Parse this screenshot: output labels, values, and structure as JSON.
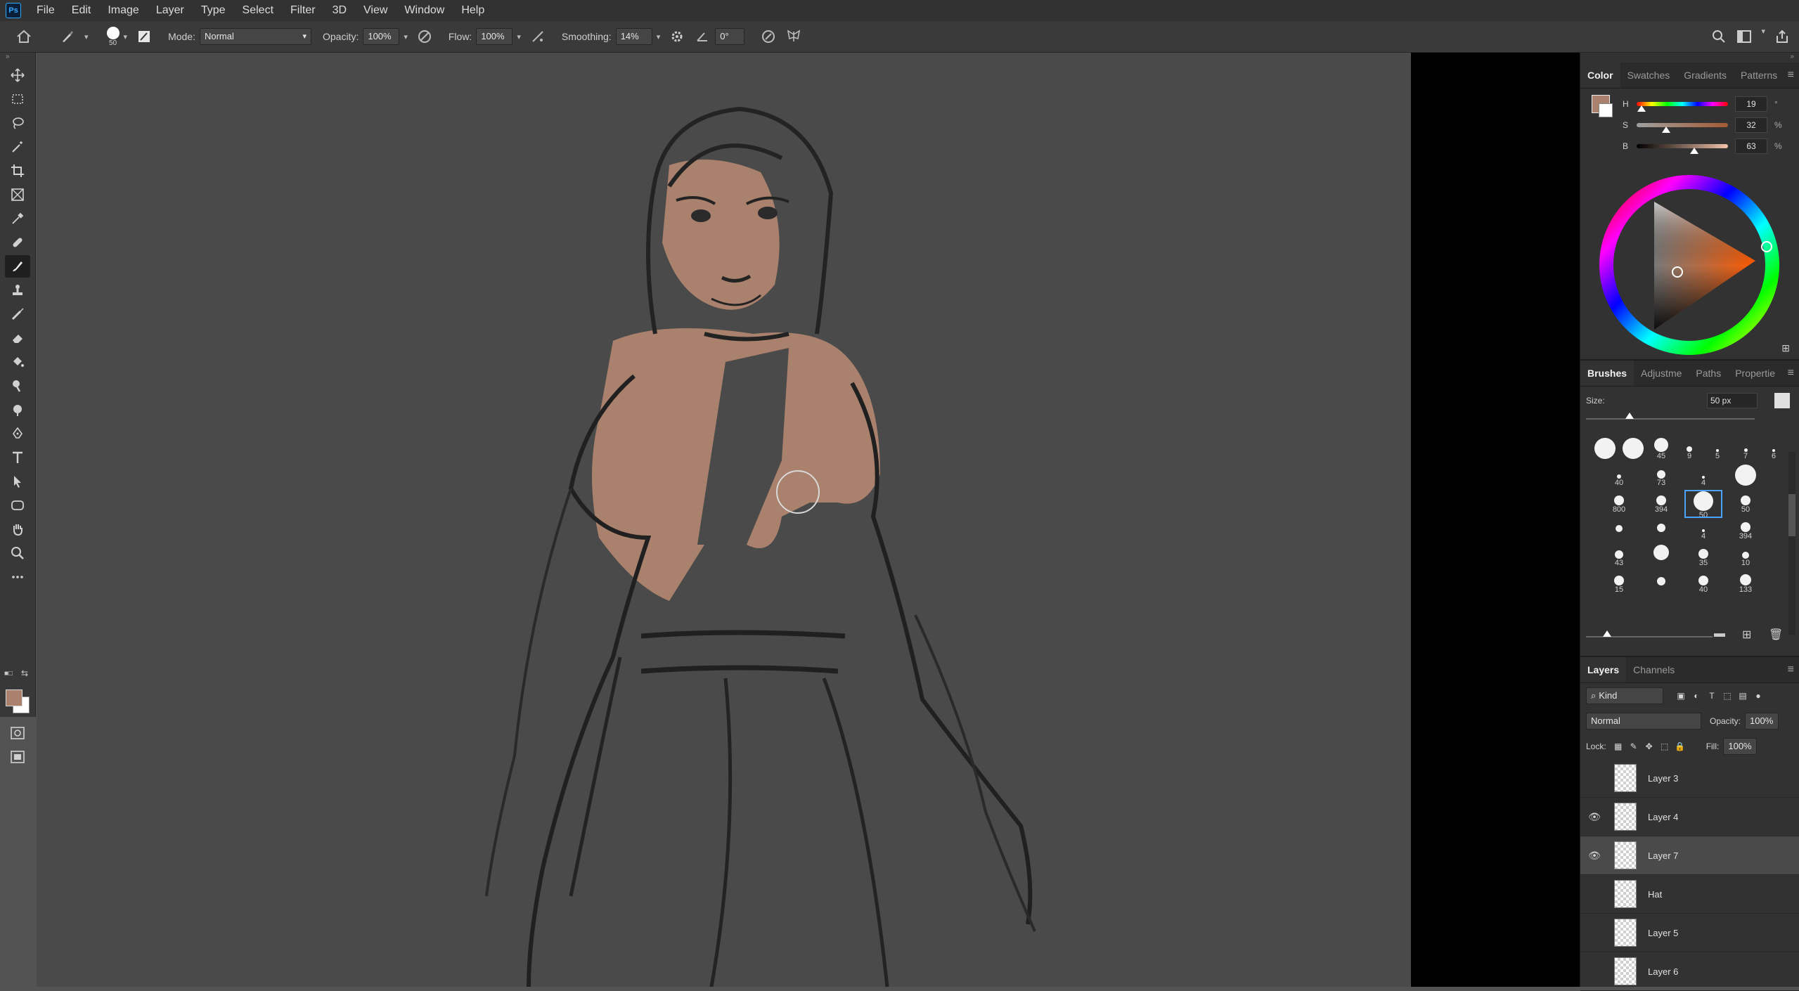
{
  "app": {
    "logo": "Ps"
  },
  "menu": [
    "File",
    "Edit",
    "Image",
    "Layer",
    "Type",
    "Select",
    "Filter",
    "3D",
    "View",
    "Window",
    "Help"
  ],
  "options": {
    "brush_size": "50",
    "mode_label": "Mode:",
    "mode_value": "Normal",
    "opacity_label": "Opacity:",
    "opacity_value": "100%",
    "flow_label": "Flow:",
    "flow_value": "100%",
    "smoothing_label": "Smoothing:",
    "smoothing_value": "14%",
    "angle_value": "0°"
  },
  "tools": [
    "move-tool",
    "marquee-tool",
    "lasso-tool",
    "magic-wand-tool",
    "crop-tool",
    "frame-tool",
    "eyedropper-tool",
    "healing-tool",
    "brush-tool",
    "stamp-tool",
    "history-brush-tool",
    "eraser-tool",
    "paint-bucket-tool",
    "smudge-tool",
    "dodge-tool",
    "pen-tool",
    "type-tool",
    "path-selection-tool",
    "rectangle-tool",
    "hand-tool",
    "zoom-tool",
    "more-tools"
  ],
  "colors": {
    "foreground": "#a9816c",
    "background": "#ffffff"
  },
  "color_panel": {
    "tabs": [
      "Color",
      "Swatches",
      "Gradients",
      "Patterns"
    ],
    "h_label": "H",
    "h_value": "19",
    "h_unit": "°",
    "h_level": 0.05,
    "s_label": "S",
    "s_value": "32",
    "s_unit": "%",
    "s_level": 0.32,
    "b_label": "B",
    "b_value": "63",
    "b_unit": "%",
    "b_level": 0.63
  },
  "brushes_panel": {
    "tabs": [
      "Brushes",
      "Adjustme",
      "Paths",
      "Propertie"
    ],
    "size_label": "Size:",
    "size_value": "50 px",
    "presets": [
      {
        "label": "",
        "size": 30
      },
      {
        "label": "",
        "size": 34
      },
      {
        "label": "45",
        "size": 20
      },
      {
        "label": "9",
        "size": 8
      },
      {
        "label": "5",
        "size": 4
      },
      {
        "label": "7",
        "size": 5
      },
      {
        "label": "6",
        "size": 4
      },
      {
        "label": "40",
        "size": 6
      },
      {
        "label": "73",
        "size": 12
      },
      {
        "label": "4",
        "size": 4
      },
      {
        "label": "",
        "size": 30
      },
      {
        "label": "800",
        "size": 14
      },
      {
        "label": "394",
        "size": 14
      },
      {
        "label": "50",
        "size": 28
      },
      {
        "label": "50",
        "size": 14
      },
      {
        "label": "",
        "size": 10
      },
      {
        "label": "",
        "size": 12
      },
      {
        "label": "4",
        "size": 4
      },
      {
        "label": "394",
        "size": 14
      },
      {
        "label": "43",
        "size": 12
      },
      {
        "label": "",
        "size": 22
      },
      {
        "label": "35",
        "size": 14
      },
      {
        "label": "10",
        "size": 10
      },
      {
        "label": "15",
        "size": 14
      },
      {
        "label": "",
        "size": 12
      },
      {
        "label": "40",
        "size": 14
      },
      {
        "label": "133",
        "size": 16
      }
    ]
  },
  "layers_panel": {
    "tabs": [
      "Layers",
      "Channels"
    ],
    "filter_label": "Kind",
    "blend_mode": "Normal",
    "opacity_label": "Opacity:",
    "opacity_value": "100%",
    "lock_label": "Lock:",
    "fill_label": "Fill:",
    "fill_value": "100%",
    "layers": [
      {
        "name": "Layer 3",
        "visible": false,
        "selected": false
      },
      {
        "name": "Layer 4",
        "visible": true,
        "selected": false
      },
      {
        "name": "Layer 7",
        "visible": true,
        "selected": true
      },
      {
        "name": "Hat",
        "visible": false,
        "selected": false
      },
      {
        "name": "Layer 5",
        "visible": false,
        "selected": false
      },
      {
        "name": "Layer 6",
        "visible": false,
        "selected": false
      }
    ]
  }
}
